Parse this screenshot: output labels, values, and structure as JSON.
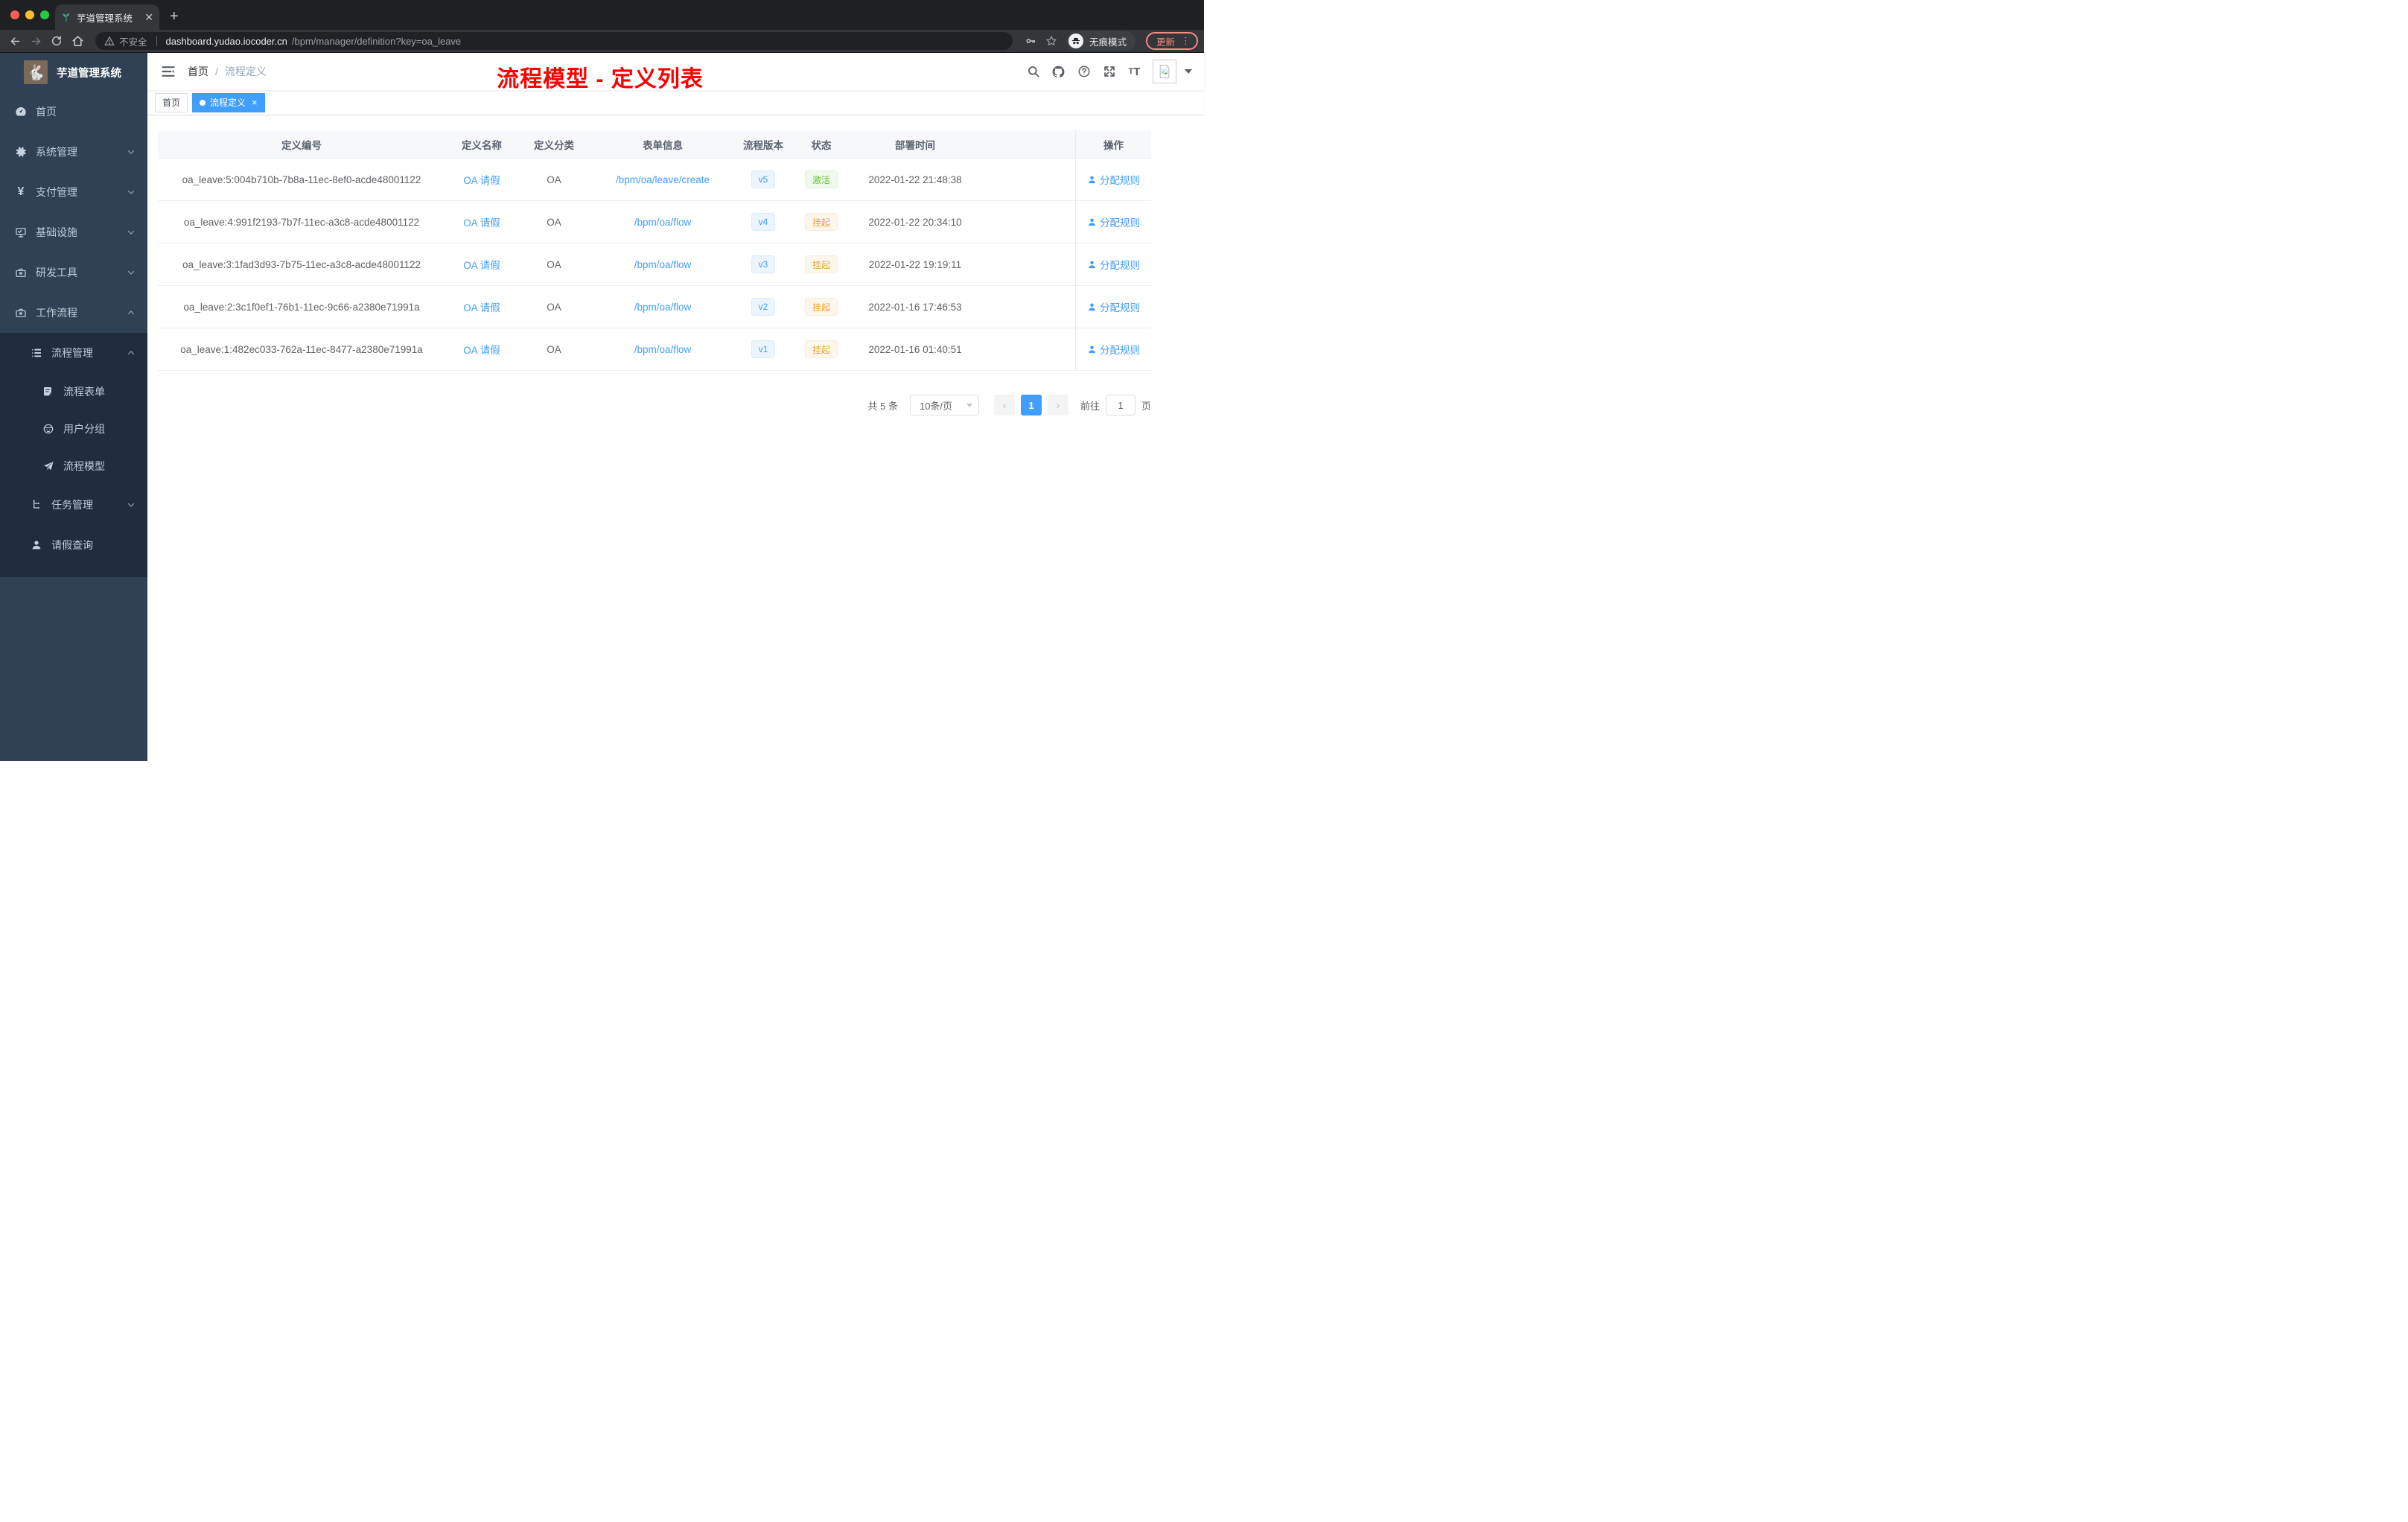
{
  "browser": {
    "tab_title": "芋道管理系统",
    "security_label": "不安全",
    "url_host": "dashboard.yudao.iocoder.cn",
    "url_path": "/bpm/manager/definition?key=oa_leave",
    "incognito_label": "无痕模式",
    "update_label": "更新"
  },
  "sidebar": {
    "logo_title": "芋道管理系统",
    "items": [
      {
        "label": "首页",
        "icon": "dashboard-icon"
      },
      {
        "label": "系统管理",
        "icon": "gear-icon",
        "chevron": "down"
      },
      {
        "label": "支付管理",
        "icon": "yen-icon",
        "chevron": "down"
      },
      {
        "label": "基础设施",
        "icon": "monitor-icon",
        "chevron": "down"
      },
      {
        "label": "研发工具",
        "icon": "toolbox-icon",
        "chevron": "down"
      },
      {
        "label": "工作流程",
        "icon": "briefcase-icon",
        "chevron": "up"
      },
      {
        "label": "流程管理",
        "icon": "list-icon",
        "chevron": "up"
      },
      {
        "label": "流程表单",
        "icon": "form-icon"
      },
      {
        "label": "用户分组",
        "icon": "user-group-icon"
      },
      {
        "label": "流程模型",
        "icon": "paper-plane-icon"
      },
      {
        "label": "任务管理",
        "icon": "tree-icon",
        "chevron": "down"
      },
      {
        "label": "请假查询",
        "icon": "person-icon"
      }
    ]
  },
  "navbar": {
    "breadcrumb_home": "首页",
    "breadcrumb_sep": "/",
    "breadcrumb_current": "流程定义",
    "annotation": "流程模型 - 定义列表"
  },
  "tags": {
    "home": "首页",
    "current": "流程定义",
    "close": "×"
  },
  "table": {
    "headers": [
      "定义编号",
      "定义名称",
      "定义分类",
      "表单信息",
      "流程版本",
      "状态",
      "部署时间",
      "操作"
    ],
    "rows": [
      {
        "id": "oa_leave:5:004b710b-7b8a-11ec-8ef0-acde48001122",
        "name": "OA 请假",
        "category": "OA",
        "form": "/bpm/oa/leave/create",
        "version": "v5",
        "status": "激活",
        "status_type": "active",
        "time": "2022-01-22 21:48:38",
        "action": "分配规则"
      },
      {
        "id": "oa_leave:4:991f2193-7b7f-11ec-a3c8-acde48001122",
        "name": "OA 请假",
        "category": "OA",
        "form": "/bpm/oa/flow",
        "version": "v4",
        "status": "挂起",
        "status_type": "suspended",
        "time": "2022-01-22 20:34:10",
        "action": "分配规则"
      },
      {
        "id": "oa_leave:3:1fad3d93-7b75-11ec-a3c8-acde48001122",
        "name": "OA 请假",
        "category": "OA",
        "form": "/bpm/oa/flow",
        "version": "v3",
        "status": "挂起",
        "status_type": "suspended",
        "time": "2022-01-22 19:19:11",
        "action": "分配规则"
      },
      {
        "id": "oa_leave:2:3c1f0ef1-76b1-11ec-9c66-a2380e71991a",
        "name": "OA 请假",
        "category": "OA",
        "form": "/bpm/oa/flow",
        "version": "v2",
        "status": "挂起",
        "status_type": "suspended",
        "time": "2022-01-16 17:46:53",
        "action": "分配规则"
      },
      {
        "id": "oa_leave:1:482ec033-762a-11ec-8477-a2380e71991a",
        "name": "OA 请假",
        "category": "OA",
        "form": "/bpm/oa/flow",
        "version": "v1",
        "status": "挂起",
        "status_type": "suspended",
        "time": "2022-01-16 01:40:51",
        "action": "分配规则"
      }
    ]
  },
  "pagination": {
    "total": "共 5 条",
    "page_size": "10条/页",
    "prev": "‹",
    "page": "1",
    "next": "›",
    "goto_label": "前往",
    "goto_value": "1",
    "unit": "页"
  },
  "colors": {
    "accent": "#409eff",
    "sidebar_bg": "#304156",
    "submenu_bg": "#1f2d3d",
    "status_active": "#67c23a",
    "status_suspended": "#e6a23c",
    "annotation_red": "#ff0000"
  }
}
